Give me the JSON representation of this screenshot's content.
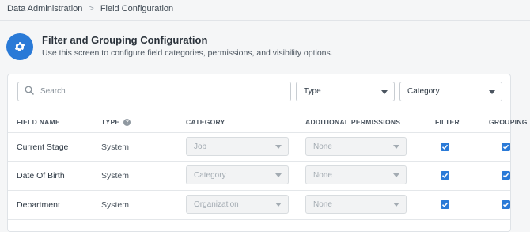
{
  "breadcrumb": {
    "items": [
      "Data Administration",
      "Field Configuration"
    ],
    "separator": ">"
  },
  "header": {
    "title": "Filter and Grouping Configuration",
    "subtitle": "Use this screen to configure field categories, permissions, and visibility options.",
    "icon": "gear-icon",
    "icon_color": "#2a7ad7"
  },
  "filters": {
    "search_placeholder": "Search",
    "type_label": "Type",
    "category_label": "Category"
  },
  "table": {
    "columns": [
      "FIELD NAME",
      "TYPE",
      "CATEGORY",
      "ADDITIONAL PERMISSIONS",
      "FILTER",
      "GROUPING"
    ],
    "rows": [
      {
        "field_name": "Current Stage",
        "type": "System",
        "category": "Job",
        "permissions": "None",
        "filter": true,
        "grouping": true
      },
      {
        "field_name": "Date Of Birth",
        "type": "System",
        "category": "Category",
        "permissions": "None",
        "filter": true,
        "grouping": true
      },
      {
        "field_name": "Department",
        "type": "System",
        "category": "Organization",
        "permissions": "None",
        "filter": true,
        "grouping": true
      }
    ]
  },
  "colors": {
    "accent": "#2a7ad7",
    "background": "#f5f6f7"
  }
}
